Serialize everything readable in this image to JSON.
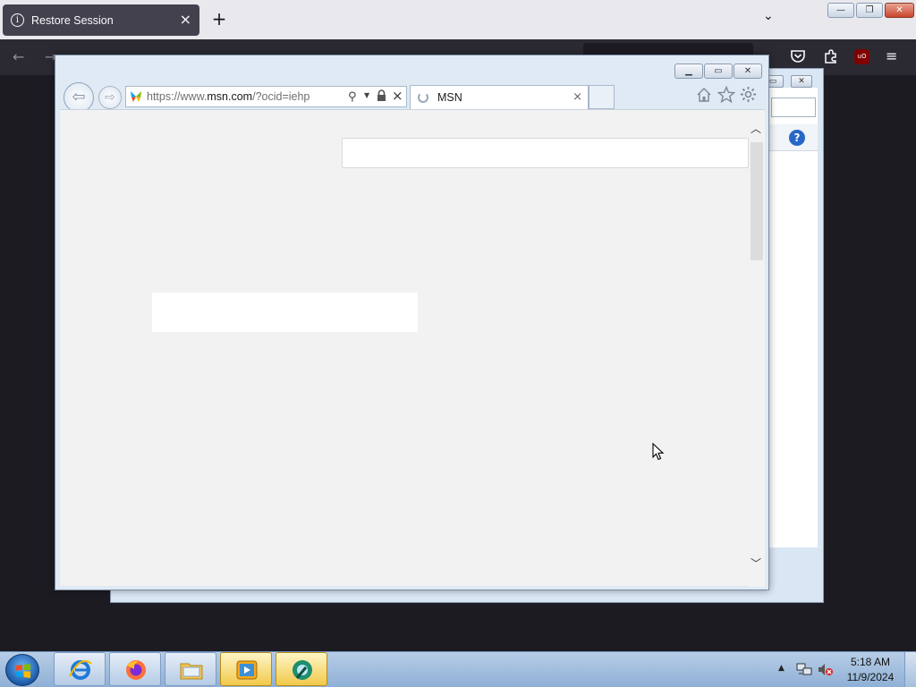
{
  "firefox": {
    "tab_title": "Restore Session",
    "tab_close": "×",
    "new_tab": "+",
    "list_tabs": "⌄",
    "back": "←",
    "forward": "→",
    "menu": "≡",
    "ublock_label": "uO"
  },
  "ie": {
    "url_scheme": "https://www.",
    "url_host": "msn.com",
    "url_path": "/?ocid=iehp",
    "tab_label": "MSN",
    "tab_close": "×",
    "stop": "×",
    "min": "▭",
    "max": "▣",
    "close": "✕",
    "back": "⇦",
    "forward": "⇨",
    "scroll_up": "︿",
    "scroll_down": "﹀"
  },
  "taskbar": {
    "time": "5:18 AM",
    "date": "11/9/2024",
    "tray_arrow": "▲",
    "buttons": [
      {
        "name": "internet-explorer",
        "active": false
      },
      {
        "name": "firefox",
        "active": false
      },
      {
        "name": "file-explorer",
        "active": false
      },
      {
        "name": "media-player",
        "active": true
      },
      {
        "name": "unknown-app",
        "active": true
      }
    ]
  },
  "colors": {
    "firefox_dark": "#2b2a33",
    "ie_frame": "#dfeaf5",
    "taskbar": "#b7cde6",
    "page_bg": "#f2f2f2"
  }
}
